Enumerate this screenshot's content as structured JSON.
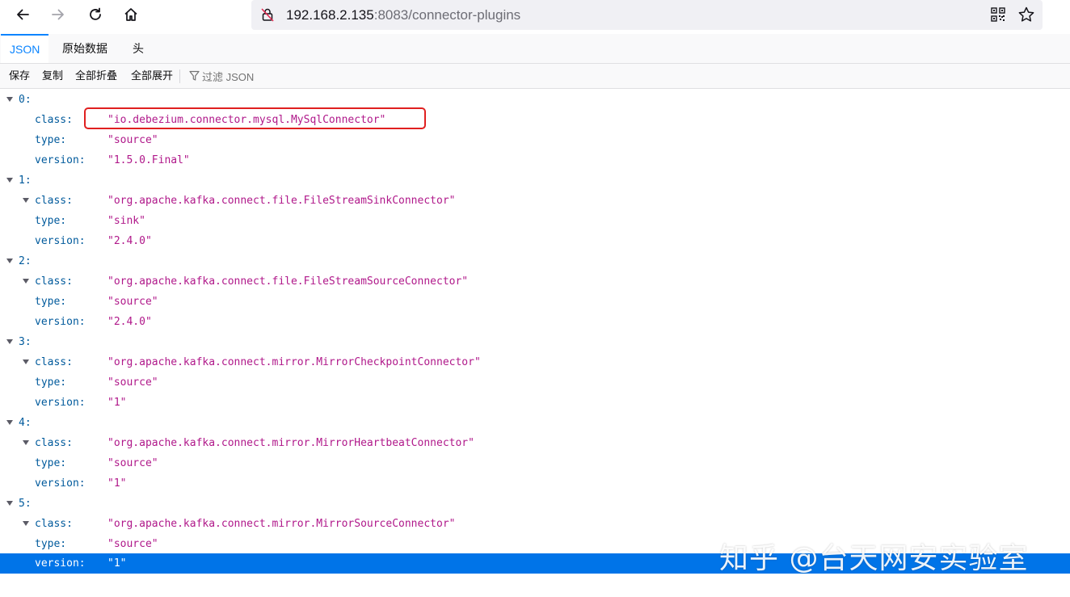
{
  "browser": {
    "url_host": "192.168.2.135",
    "url_rest": ":8083/connector-plugins"
  },
  "tabs": [
    {
      "label": "JSON",
      "active": true
    },
    {
      "label": "原始数据",
      "active": false
    },
    {
      "label": "头",
      "active": false
    }
  ],
  "toolbar": {
    "save": "保存",
    "copy": "复制",
    "collapse_all": "全部折叠",
    "expand_all": "全部展开",
    "filter_placeholder": "过滤 JSON"
  },
  "plugins": [
    {
      "index": "0:",
      "class": "\"io.debezium.connector.mysql.MySqlConnector\"",
      "type": "\"source\"",
      "version": "\"1.5.0.Final\""
    },
    {
      "index": "1:",
      "class": "\"org.apache.kafka.connect.file.FileStreamSinkConnector\"",
      "type": "\"sink\"",
      "version": "\"2.4.0\""
    },
    {
      "index": "2:",
      "class": "\"org.apache.kafka.connect.file.FileStreamSourceConnector\"",
      "type": "\"source\"",
      "version": "\"2.4.0\""
    },
    {
      "index": "3:",
      "class": "\"org.apache.kafka.connect.mirror.MirrorCheckpointConnector\"",
      "type": "\"source\"",
      "version": "\"1\""
    },
    {
      "index": "4:",
      "class": "\"org.apache.kafka.connect.mirror.MirrorHeartbeatConnector\"",
      "type": "\"source\"",
      "version": "\"1\""
    },
    {
      "index": "5:",
      "class": "\"org.apache.kafka.connect.mirror.MirrorSourceConnector\"",
      "type": "\"source\"",
      "version": "\"1\""
    }
  ],
  "keys": {
    "class": "class:",
    "type": "type:",
    "version": "version:"
  },
  "watermark": "知乎 @台天网安实验室",
  "colors": {
    "accent": "#0a84ff",
    "key": "#005a9c",
    "string": "#b0188a",
    "selected_row": "#0074e8",
    "highlight": "#e02020"
  }
}
